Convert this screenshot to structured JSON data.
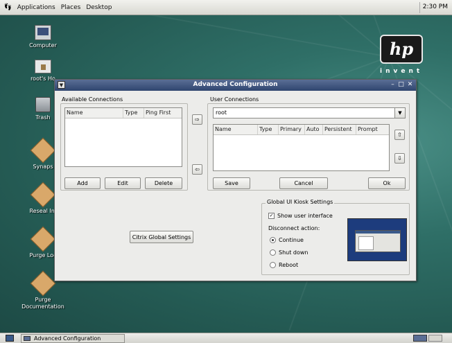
{
  "top_panel": {
    "menus": [
      "Applications",
      "Places",
      "Desktop"
    ],
    "clock": "2:30 PM"
  },
  "desktop": {
    "icons": [
      {
        "label": "Computer",
        "icon": "computer-icon"
      },
      {
        "label": "root's Ho",
        "icon": "home-folder-icon"
      },
      {
        "label": "Trash",
        "icon": "trash-icon"
      },
      {
        "label": "Synaps",
        "icon": "package-icon"
      },
      {
        "label": "Reseal Im",
        "icon": "package-icon"
      },
      {
        "label": "Purge Loc",
        "icon": "package-icon"
      },
      {
        "label": "Purge",
        "label2": "Documentation",
        "icon": "package-icon"
      }
    ],
    "brand": {
      "logo": "hp",
      "tagline": "invent"
    }
  },
  "window": {
    "title": "Advanced Configuration",
    "available": {
      "heading": "Available Connections",
      "columns": [
        "Name",
        "Type",
        "Ping First"
      ],
      "buttons": {
        "add": "Add",
        "edit": "Edit",
        "delete": "Delete"
      }
    },
    "user": {
      "heading": "User Connections",
      "selected_user": "root",
      "columns": [
        "Name",
        "Type",
        "Primary",
        "Auto",
        "Persistent",
        "Prompt"
      ],
      "buttons": {
        "save": "Save",
        "cancel": "Cancel",
        "ok": "Ok"
      }
    },
    "arrows": {
      "right": "⇨",
      "left": "⇦",
      "up": "⇧",
      "down": "⇩"
    },
    "citrix_button": "Citrix Global Settings",
    "kiosk": {
      "heading": "Global UI Kiosk Settings",
      "show_ui_label": "Show user interface",
      "show_ui_checked": true,
      "disconnect_label": "Disconnect action:",
      "options": [
        "Continue",
        "Shut down",
        "Reboot"
      ],
      "selected_option": "Continue"
    }
  },
  "taskbar": {
    "task": "Advanced Configuration"
  },
  "colors": {
    "titlebar": "#3b5079",
    "desktop": "#2e6e66",
    "preview_bg": "#1d3c7d"
  }
}
